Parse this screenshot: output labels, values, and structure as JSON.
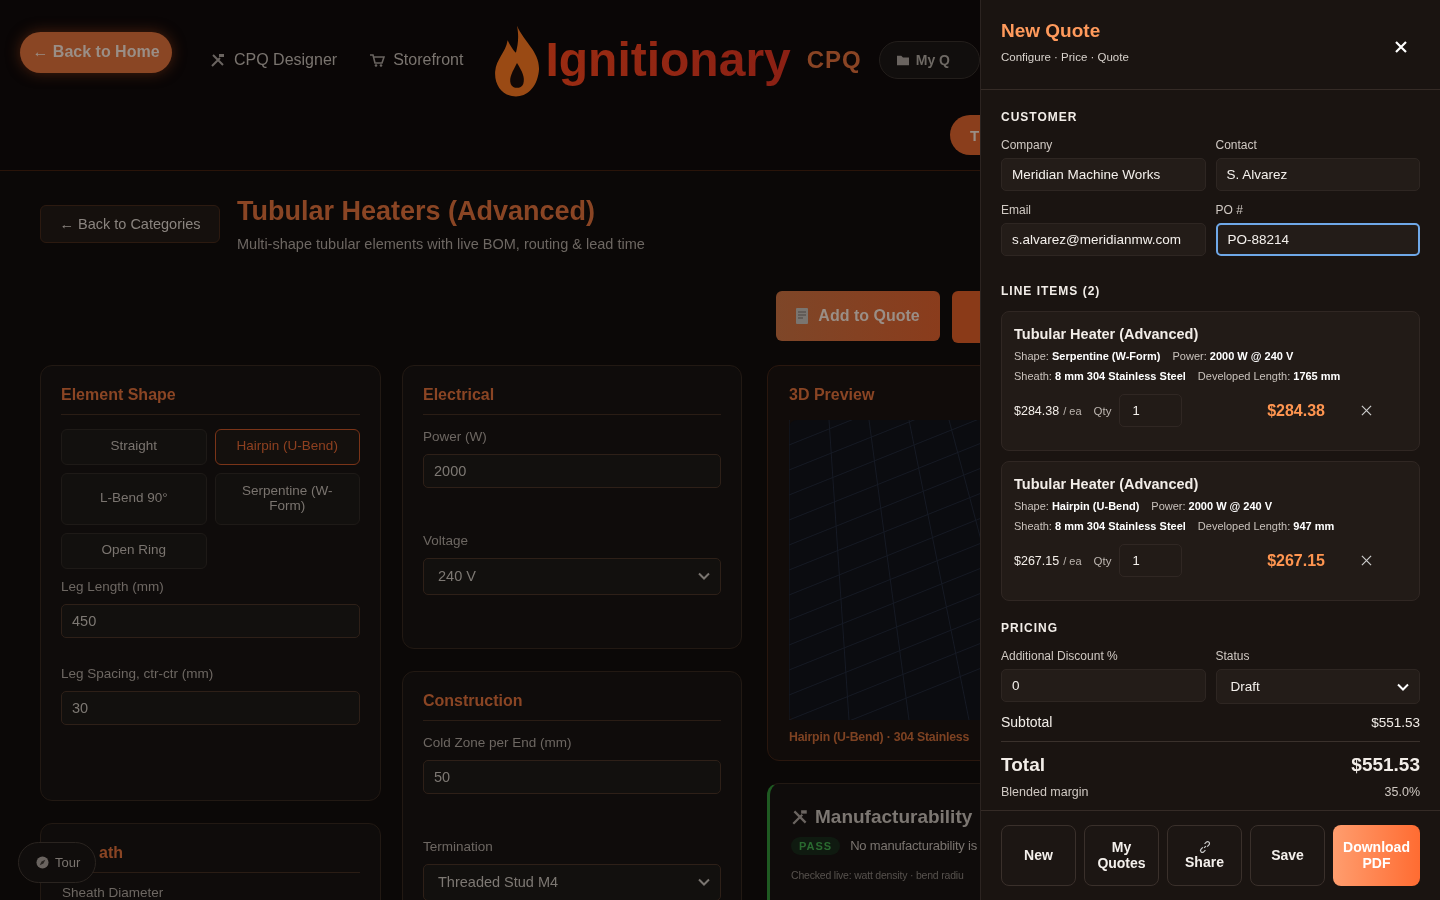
{
  "header": {
    "back_button": "← Back to Home",
    "nav": [
      {
        "label": "CPQ Designer"
      },
      {
        "label": "Storefront"
      }
    ],
    "logo": {
      "name": "Ignitionary",
      "suffix": "CPQ"
    },
    "my_quotes_button": "My Q",
    "second_button": "T"
  },
  "page": {
    "back_button": "← Back to Categories",
    "title": "Tubular Heaters (Advanced)",
    "subtitle": "Multi-shape tubular elements with live BOM, routing & lead time",
    "add_button": "Add to Quote"
  },
  "element_shape": {
    "title": "Element Shape",
    "options": [
      {
        "label": "Straight",
        "selected": false
      },
      {
        "label": "Hairpin (U-Bend)",
        "selected": true
      },
      {
        "label": "L-Bend 90°",
        "selected": false
      },
      {
        "label": "Serpentine (W-Form)",
        "selected": false
      },
      {
        "label": "Open Ring",
        "selected": false
      }
    ],
    "fields": [
      {
        "label": "Leg Length (mm)",
        "value": "450"
      },
      {
        "label": "Leg Spacing, ctr-ctr (mm)",
        "value": "30"
      }
    ]
  },
  "sheath": {
    "title": "ath",
    "field_label": "Sheath Diameter"
  },
  "electrical": {
    "title": "Electrical",
    "fields": [
      {
        "label": "Power (W)",
        "value": "2000",
        "kind": "input"
      },
      {
        "label": "Voltage",
        "value": "240 V",
        "kind": "select"
      }
    ]
  },
  "construction": {
    "title": "Construction",
    "fields": [
      {
        "label": "Cold Zone per End (mm)",
        "value": "50",
        "kind": "input"
      },
      {
        "label": "Termination",
        "value": "Threaded Stud M4",
        "kind": "select"
      }
    ]
  },
  "preview": {
    "title": "3D Preview",
    "caption": "Hairpin (U-Bend) · 304 Stainless"
  },
  "manufacturability": {
    "title": "Manufacturability",
    "badge": "PASS",
    "message": "No manufacturability is",
    "note": "Checked live: watt density · bend radiu"
  },
  "tour_button": "Tour",
  "quote": {
    "title": "New Quote",
    "subtitle": "Configure · Price · Quote",
    "customer": {
      "heading": "CUSTOMER",
      "fields": [
        {
          "label": "Company",
          "value": "Meridian Machine Works",
          "focused": false
        },
        {
          "label": "Contact",
          "value": "S. Alvarez",
          "focused": false
        },
        {
          "label": "Email",
          "value": "s.alvarez@meridianmw.com",
          "focused": false
        },
        {
          "label": "PO #",
          "value": "PO-88214",
          "focused": true
        }
      ]
    },
    "line_items": {
      "heading": "LINE ITEMS (2)",
      "items": [
        {
          "name": "Tubular Heater (Advanced)",
          "specs": [
            [
              "Shape: **Serpentine (W-Form)**",
              "Power: **2000 W @ 240 V**"
            ],
            [
              "Sheath: **8 mm 304 Stainless Steel**",
              "Developed Length: **1765 mm**"
            ]
          ],
          "unit_price": "$284.38",
          "unit": "/ ea",
          "qty_label": "Qty",
          "qty": "1",
          "total": "$284.38"
        },
        {
          "name": "Tubular Heater (Advanced)",
          "specs": [
            [
              "Shape: **Hairpin (U-Bend)**",
              "Power: **2000 W @ 240 V**"
            ],
            [
              "Sheath: **8 mm 304 Stainless Steel**",
              "Developed Length: **947 mm**"
            ]
          ],
          "unit_price": "$267.15",
          "unit": "/ ea",
          "qty_label": "Qty",
          "qty": "1",
          "total": "$267.15"
        }
      ]
    },
    "pricing": {
      "heading": "PRICING",
      "discount": {
        "label": "Additional Discount %",
        "value": "0"
      },
      "status": {
        "label": "Status",
        "value": "Draft"
      },
      "subtotal": {
        "label": "Subtotal",
        "value": "$551.53"
      },
      "total": {
        "label": "Total",
        "value": "$551.53"
      },
      "margin": {
        "label": "Blended margin",
        "value": "35.0%"
      }
    },
    "actions": [
      {
        "label": "New",
        "kind": "plain"
      },
      {
        "label": "My Quotes",
        "kind": "plain"
      },
      {
        "label": "Share",
        "kind": "share"
      },
      {
        "label": "Save",
        "kind": "plain"
      },
      {
        "label": "Download PDF",
        "kind": "primary"
      }
    ]
  }
}
